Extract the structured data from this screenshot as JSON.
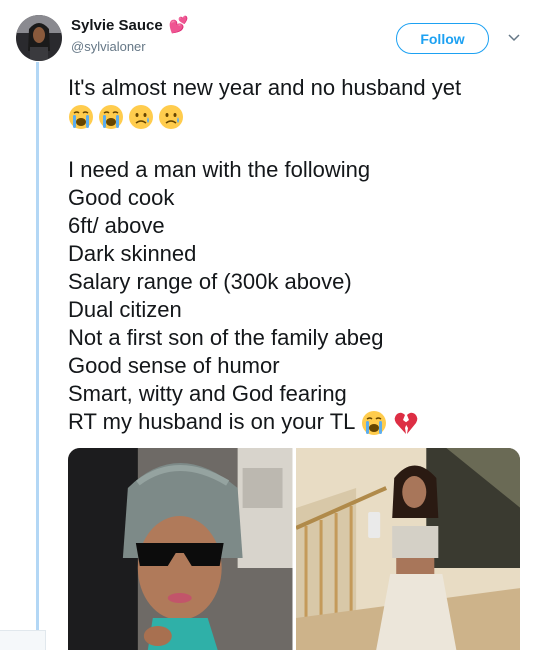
{
  "tweet": {
    "author": {
      "name": "Sylvie Sauce",
      "handle": "@sylvialoner",
      "name_emoji": "💕"
    },
    "follow_label": "Follow",
    "lines": [
      "It's almost new year and no husband yet",
      "I need a man with the following",
      "Good cook",
      "6ft/ above",
      "Dark skinned",
      "Salary range of (300k above)",
      "Dual citizen",
      "Not a first son of the family abeg",
      "Good sense of humor",
      "Smart, witty and God fearing",
      "RT my husband is on your TL"
    ],
    "emoji_row_1": [
      "loudly-crying-face",
      "loudly-crying-face",
      "sad-but-relieved-face",
      "sad-but-relieved-face"
    ],
    "emoji_row_2": [
      "loudly-crying-face",
      "broken-heart"
    ],
    "media": [
      {
        "description_icon": "photo-woman-headwrap-sunglasses"
      },
      {
        "description_icon": "photo-woman-staircase"
      }
    ]
  },
  "colors": {
    "accent": "#1da1f2",
    "thread_line": "#b3d7f5",
    "text": "#14171a",
    "secondary_text": "#657786"
  }
}
